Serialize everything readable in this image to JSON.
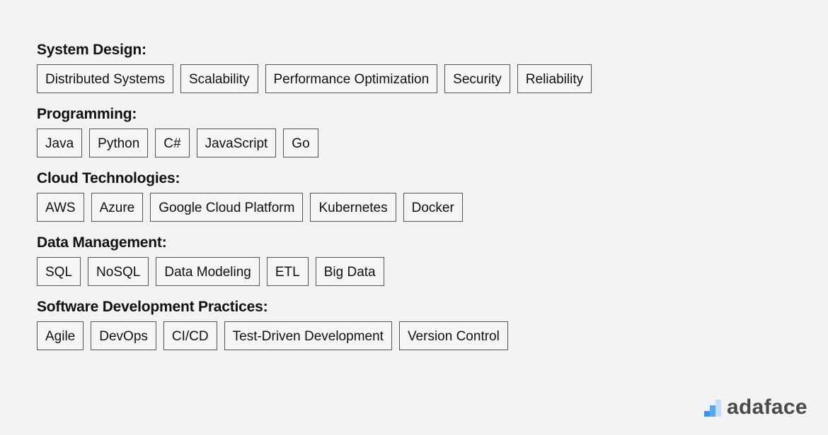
{
  "sections": [
    {
      "title": "System Design:",
      "tags": [
        "Distributed Systems",
        "Scalability",
        "Performance Optimization",
        "Security",
        "Reliability"
      ]
    },
    {
      "title": "Programming:",
      "tags": [
        "Java",
        "Python",
        "C#",
        "JavaScript",
        "Go"
      ]
    },
    {
      "title": "Cloud Technologies:",
      "tags": [
        "AWS",
        "Azure",
        "Google Cloud Platform",
        "Kubernetes",
        "Docker"
      ]
    },
    {
      "title": "Data Management:",
      "tags": [
        "SQL",
        "NoSQL",
        "Data Modeling",
        "ETL",
        "Big Data"
      ]
    },
    {
      "title": "Software Development Practices:",
      "tags": [
        "Agile",
        "DevOps",
        "CI/CD",
        "Test-Driven Development",
        "Version Control"
      ]
    }
  ],
  "logo": {
    "text": "adaface",
    "icon": "bar-chart-logo-icon",
    "colors": [
      "#3b95e6",
      "#56a9ee",
      "#bfe0f8"
    ]
  }
}
